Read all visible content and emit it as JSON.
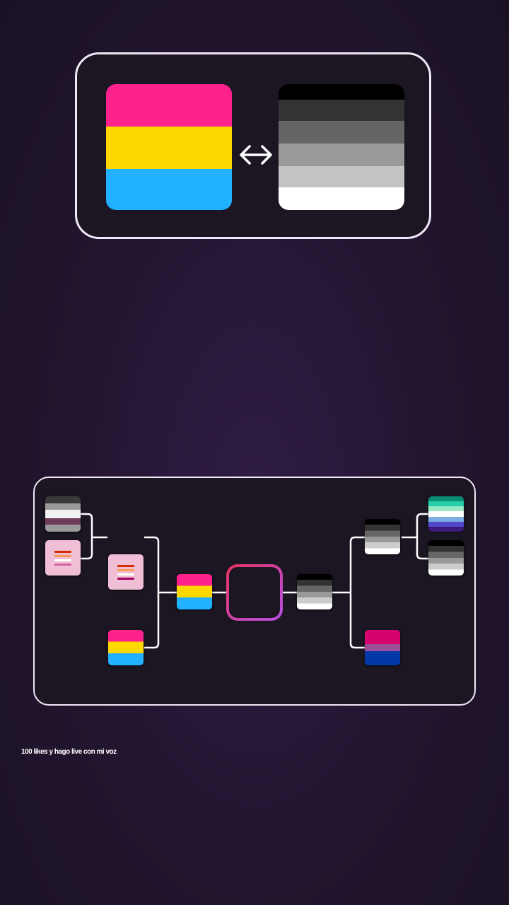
{
  "matchup": {
    "left_flag": "pansexual-flag",
    "right_flag": "heterosexual-flag",
    "swap_icon": "double-arrow-icon"
  },
  "bracket": {
    "left_round1": [
      "demisexual-flag",
      "lesbian-flag"
    ],
    "left_round2": [
      "lesbian-flag",
      "pansexual-flag"
    ],
    "left_semifinal": "pansexual-flag",
    "right_round1": [
      "gay-men-flag",
      "heterosexual-flag"
    ],
    "right_round2": [
      "heterosexual-flag",
      "bisexual-flag"
    ],
    "right_semifinal": "heterosexual-flag",
    "winner": ""
  },
  "caption": "100 likes y hago live con mi voz",
  "colors": {
    "frame": "#f1e8f7",
    "winner_gradient": [
      "#e8335f",
      "#b550e6"
    ]
  }
}
